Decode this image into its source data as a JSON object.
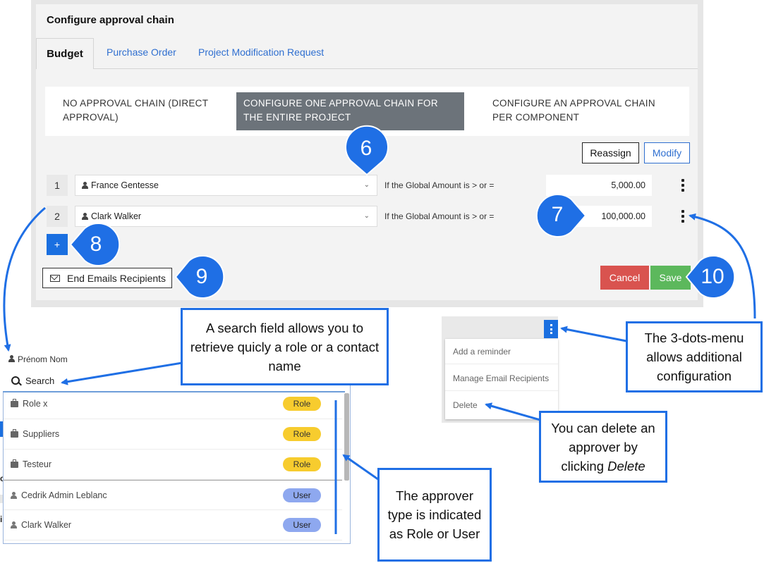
{
  "modal": {
    "title": "Configure approval chain",
    "tabs": [
      "Budget",
      "Purchase Order",
      "Project Modification Request"
    ],
    "modes": [
      "NO APPROVAL CHAIN (DIRECT APPROVAL)",
      "CONFIGURE ONE APPROVAL CHAIN FOR THE ENTIRE PROJECT",
      "CONFIGURE AN APPROVAL CHAIN PER COMPONENT"
    ],
    "reassign_label": "Reassign",
    "modify_label": "Modify",
    "approvers": [
      {
        "num": "1",
        "name": "France Gentesse",
        "condition": "If the Global Amount is > or =",
        "amount": "5,000.00"
      },
      {
        "num": "2",
        "name": "Clark Walker",
        "condition": "If the Global Amount is > or =",
        "amount": "100,000.00"
      }
    ],
    "add_label": "+",
    "emails_label": "End Emails Recipients",
    "cancel_label": "Cancel",
    "save_label": "Save"
  },
  "dropdown": {
    "label": "Prénom Nom",
    "search_placeholder": "Search",
    "items": [
      {
        "name": "Role x",
        "type": "Role"
      },
      {
        "name": "Suppliers",
        "type": "Role"
      },
      {
        "name": "Testeur",
        "type": "Role"
      },
      {
        "name": "Cedrik Admin Leblanc",
        "type": "User"
      },
      {
        "name": "Clark Walker",
        "type": "User"
      }
    ]
  },
  "context_menu": {
    "items": [
      "Add a reminder",
      "Manage Email Recipients",
      "Delete"
    ]
  },
  "markers": [
    "6",
    "7",
    "8",
    "9",
    "10"
  ],
  "callouts": {
    "search": "A search field allows you to retrieve quicly a role or a contact name",
    "three_dots": "The 3-dots-menu allows additional configuration",
    "delete_prefix": "You can delete an approver by clicking ",
    "delete_emph": "Delete",
    "type": "The approver type is indicated as Role or User"
  },
  "colors": {
    "accent_blue": "#1f6fe5",
    "cancel_red": "#d9534f",
    "save_green": "#5cb85c",
    "role_badge": "#f7cc2e",
    "user_badge": "#8ea8ef",
    "selected_mode": "#6c737a"
  }
}
